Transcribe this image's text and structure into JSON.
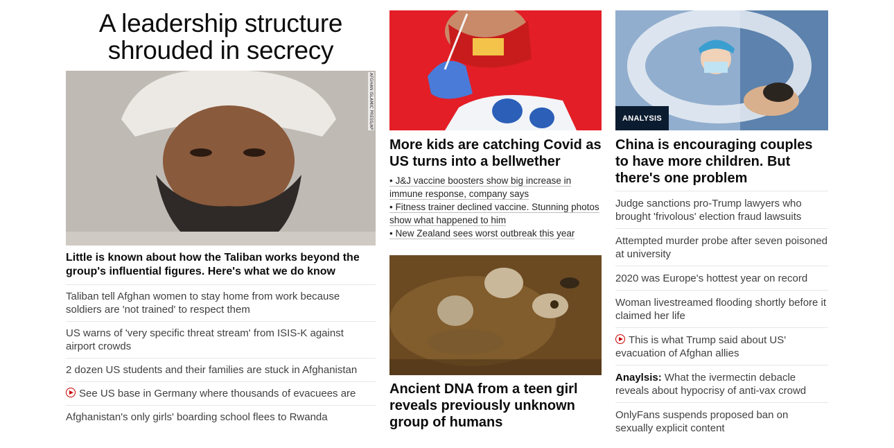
{
  "left": {
    "headline": "A leadership structure shrouded in secrecy",
    "image_credit": "AFGHAN ISLAMIC PRESS/AP",
    "lead": "Little is known about how the Taliban works beyond the group's influential figures. Here's what we do know",
    "items": [
      {
        "text": "Taliban tell Afghan women to stay home from work because soldiers are 'not trained' to respect them",
        "video": false
      },
      {
        "text": "US warns of 'very specific threat stream' from ISIS-K against airport crowds",
        "video": false
      },
      {
        "text": "2 dozen US students and their families are stuck in Afghanistan",
        "video": false
      },
      {
        "text": "See US base in Germany where thousands of evacuees are",
        "video": true
      },
      {
        "text": "Afghanistan's only girls' boarding school flees to Rwanda",
        "video": false
      }
    ]
  },
  "middle": {
    "covid_title": "More kids are catching Covid as US turns into a bellwether",
    "covid_bullets": [
      "• J&J vaccine boosters show big increase in immune response, company says",
      "• Fitness trainer declined vaccine. Stunning photos show what happened to him",
      "• New Zealand sees worst outbreak this year"
    ],
    "dna_title": "Ancient DNA from a teen girl reveals previously unknown group of humans"
  },
  "right": {
    "tag": "ANALYSIS",
    "title": "China is encouraging couples to have more children. But there's one problem",
    "items": [
      {
        "prefix": "",
        "text": "Judge sanctions pro-Trump lawyers who brought 'frivolous' election fraud lawsuits",
        "video": false
      },
      {
        "prefix": "",
        "text": "Attempted murder probe after seven poisoned at university",
        "video": false
      },
      {
        "prefix": "",
        "text": "2020 was Europe's hottest year on record",
        "video": false
      },
      {
        "prefix": "",
        "text": "Woman livestreamed flooding shortly before it claimed her life",
        "video": false
      },
      {
        "prefix": "",
        "text": "This is what Trump said about US' evacuation of Afghan allies",
        "video": true
      },
      {
        "prefix": "Anaylsis:",
        "text": " What the ivermectin debacle reveals about hypocrisy of anti-vax crowd",
        "video": false
      },
      {
        "prefix": "",
        "text": "OnlyFans suspends proposed ban on sexually explicit content",
        "video": false
      }
    ]
  },
  "colors": {
    "video_red": "#cc0000",
    "tag_bg": "#0c1c30",
    "divider": "#e6e6e6"
  }
}
